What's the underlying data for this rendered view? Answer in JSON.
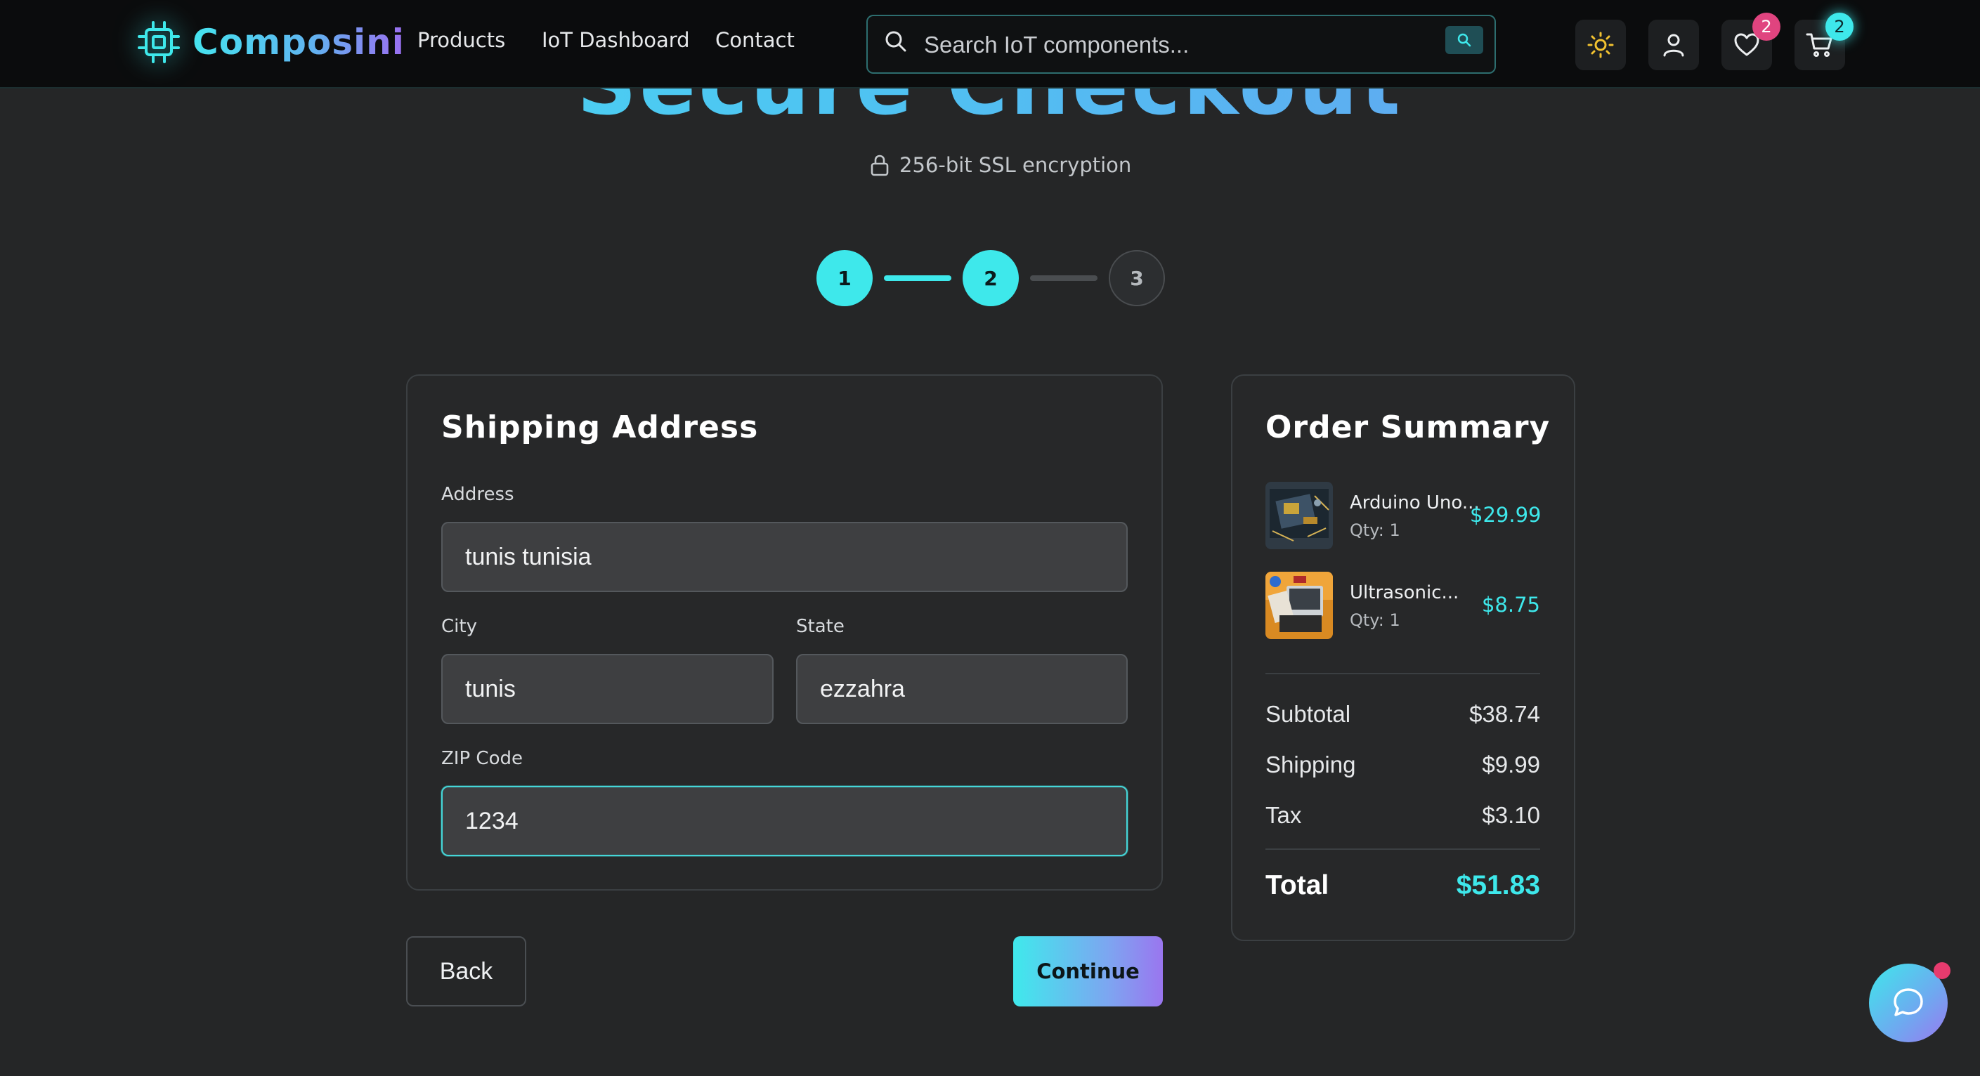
{
  "header": {
    "brand": "Composini",
    "nav": [
      "Products",
      "IoT Dashboard",
      "Contact"
    ],
    "search_placeholder": "Search IoT components...",
    "wishlist_count": "2",
    "cart_count": "2",
    "accent": "#3ee8eb"
  },
  "page": {
    "title": "Secure Checkout",
    "ssl_note": "256-bit SSL encryption"
  },
  "stepper": {
    "steps": [
      "1",
      "2",
      "3"
    ],
    "current_step": 2
  },
  "shipping": {
    "title": "Shipping Address",
    "address_label": "Address",
    "address_value": "tunis tunisia",
    "city_label": "City",
    "city_value": "tunis",
    "state_label": "State",
    "state_value": "ezzahra",
    "zip_label": "ZIP Code",
    "zip_value": "1234"
  },
  "actions": {
    "back_label": "Back",
    "continue_label": "Continue"
  },
  "summary": {
    "title": "Order Summary",
    "items": [
      {
        "name": "Arduino Uno...",
        "qty": "Qty: 1",
        "price": "$29.99"
      },
      {
        "name": "Ultrasonic...",
        "qty": "Qty: 1",
        "price": "$8.75"
      }
    ],
    "subtotal_label": "Subtotal",
    "subtotal_value": "$38.74",
    "shipping_label": "Shipping",
    "shipping_value": "$9.99",
    "tax_label": "Tax",
    "tax_value": "$3.10",
    "total_label": "Total",
    "total_value": "$51.83"
  },
  "icons": [
    "chip-logo-icon",
    "search-icon",
    "sun-icon",
    "user-icon",
    "heart-icon",
    "cart-icon",
    "lock-icon",
    "chat-icon"
  ]
}
